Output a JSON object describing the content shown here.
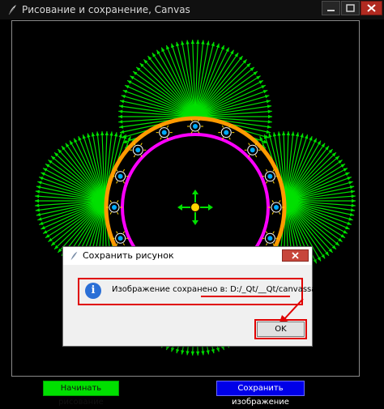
{
  "window": {
    "title": "Рисование и сохранение, Canvas",
    "app_icon": "feather-icon",
    "controls": [
      "minimize-icon",
      "maximize-icon",
      "close-icon"
    ]
  },
  "canvas": {
    "background": "#000000",
    "colors": {
      "petals": "#00e000",
      "outer_ring": "#ff9a00",
      "inner_ring": "#ff00ff",
      "center": "#ffd400",
      "arrows": "#00e000",
      "nodes": "#00aaff"
    }
  },
  "buttons": {
    "start_label": "Начинать рисование",
    "save_label": "Сохранить изображение"
  },
  "dialog": {
    "title": "Сохранить рисунок",
    "message": "Изображение сохранено в: D:/_Qt/__Qt/canvassave.png",
    "ok_label": "OK",
    "icon": "info-icon",
    "close_icon": "close-icon"
  },
  "annotations": {
    "highlight_color": "#e00000"
  }
}
